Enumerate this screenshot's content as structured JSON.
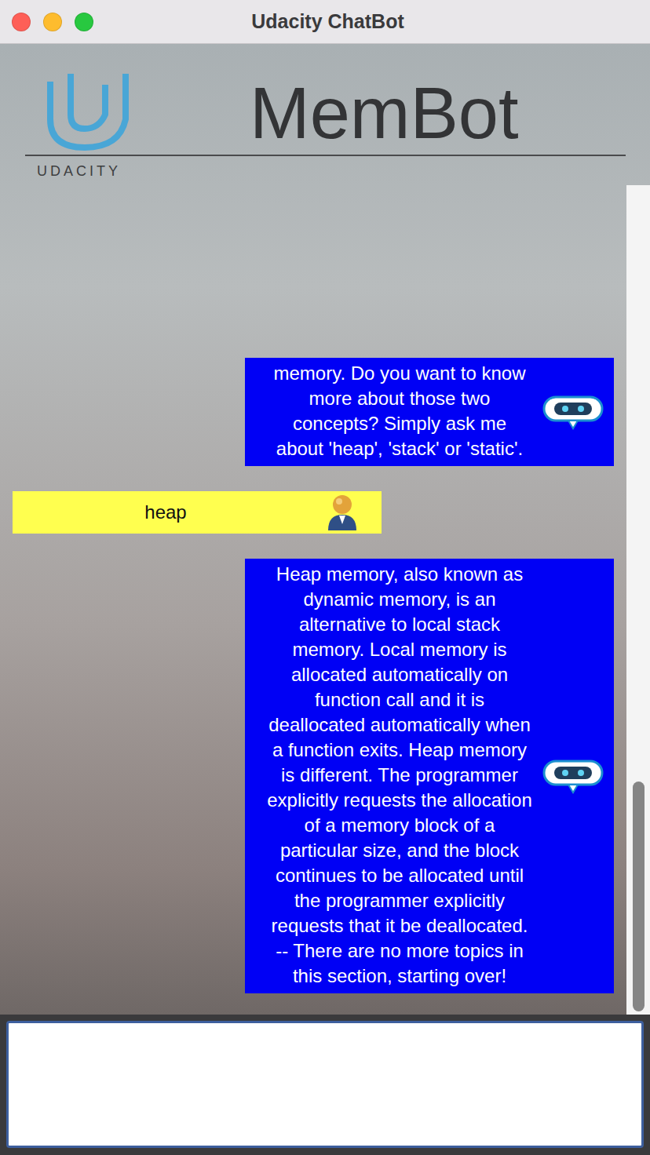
{
  "window": {
    "title": "Udacity ChatBot"
  },
  "header": {
    "brand": "UDACITY",
    "title": "MemBot"
  },
  "messages": [
    {
      "kind": "bot",
      "text": "memory. Do you want to know more about those two concepts? Simply ask me about 'heap', 'stack' or 'static'."
    },
    {
      "kind": "user",
      "text": "heap"
    },
    {
      "kind": "bot",
      "text": "Heap memory, also known as dynamic memory, is an alternative to local stack memory. Local memory is allocated automatically on function call and it is deallocated automatically when a function exits. Heap memory is different. The programmer explicitly requests the allocation of a memory block of a particular size, and the block continues to be allocated until the programmer explicitly requests that it be deallocated. -- There are no more topics in this section, starting over!"
    }
  ],
  "scrollbar": {
    "level": 1
  },
  "input": {
    "value": ""
  }
}
